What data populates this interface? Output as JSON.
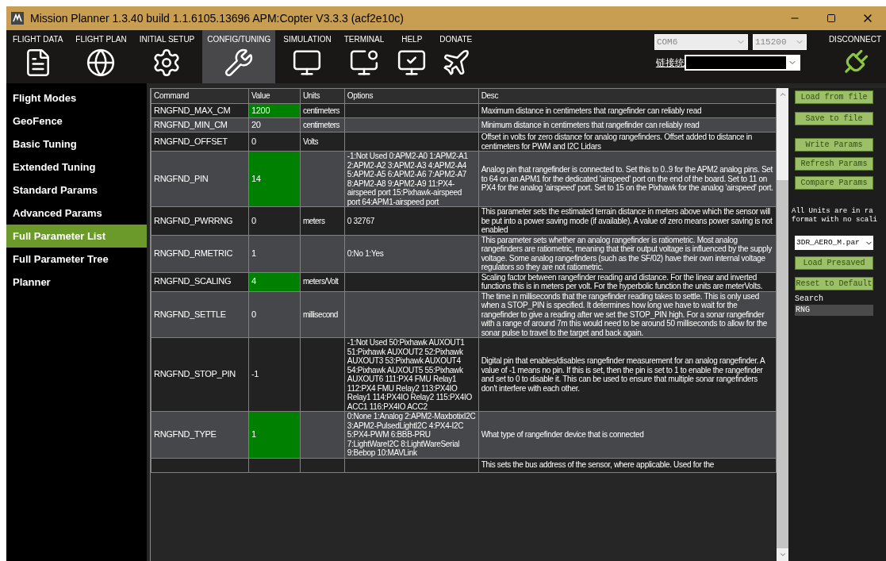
{
  "window": {
    "title": "Mission Planner 1.3.40 build 1.1.6105.13696 APM:Copter V3.3.3 (acf2e10c)"
  },
  "toolbar": {
    "tabs": [
      {
        "label": "FLIGHT DATA",
        "selected": false
      },
      {
        "label": "FLIGHT PLAN",
        "selected": false
      },
      {
        "label": "INITIAL SETUP",
        "selected": false
      },
      {
        "label": "CONFIG/TUNING",
        "selected": true
      },
      {
        "label": "SIMULATION",
        "selected": false
      },
      {
        "label": "TERMINAL",
        "selected": false
      },
      {
        "label": "HELP",
        "selected": false
      },
      {
        "label": "DONATE",
        "selected": false
      }
    ],
    "port": "COM6",
    "baud": "115200",
    "link_stats": "链接统",
    "disconnect": "DISCONNECT"
  },
  "sidebar": {
    "items": [
      {
        "label": "Flight Modes",
        "selected": false
      },
      {
        "label": "GeoFence",
        "selected": false
      },
      {
        "label": "Basic Tuning",
        "selected": false
      },
      {
        "label": "Extended Tuning",
        "selected": false
      },
      {
        "label": "Standard Params",
        "selected": false
      },
      {
        "label": "Advanced Params",
        "selected": false
      },
      {
        "label": "Full Parameter List",
        "selected": true
      },
      {
        "label": "Full Parameter Tree",
        "selected": false
      },
      {
        "label": "Planner",
        "selected": false
      }
    ]
  },
  "table": {
    "columns": [
      "Command",
      "Value",
      "Units",
      "Options",
      "Desc"
    ],
    "rows": [
      {
        "command": "RNGFND_MAX_CM",
        "value": "1200",
        "highlighted": true,
        "units": "centimeters",
        "options": "",
        "desc": "Maximum distance in centimeters that rangefinder can reliably read"
      },
      {
        "command": "RNGFND_MIN_CM",
        "value": "20",
        "highlighted": false,
        "units": "centimeters",
        "options": "",
        "desc": "Minimum distance in centimeters that rangefinder can reliably read"
      },
      {
        "command": "RNGFND_OFFSET",
        "value": "0",
        "highlighted": false,
        "units": "Volts",
        "options": "",
        "desc": "Offset in volts for zero distance for analog rangefinders. Offset added to distance in centimeters for PWM and I2C Lidars"
      },
      {
        "command": "RNGFND_PIN",
        "value": "14",
        "highlighted": true,
        "units": "",
        "options": "-1:Not Used  0:APM2-A0 1:APM2-A1  2:APM2-A2 3:APM2-A3  4:APM2-A4 5:APM2-A5  6:APM2-A6 7:APM2-A7  8:APM2-A8 9:APM2-A9  11:PX4-airspeed port 15:Pixhawk-airspeed port 64:APM1-airspeed port",
        "desc": "Analog pin that rangefinder is connected to. Set this to 0..9 for the APM2 analog pins. Set to 64 on an APM1 for the dedicated 'airspeed' port on the end of the board. Set to 11 on PX4 for the analog 'airspeed' port. Set to 15 on the Pixhawk for the analog 'airspeed' port."
      },
      {
        "command": "RNGFND_PWRRNG",
        "value": "0",
        "highlighted": false,
        "units": "meters",
        "options": "0 32767",
        "desc": "This parameter sets the estimated terrain distance in meters above which the sensor will be put into a power saving mode (if available). A value of zero means power saving is not enabled"
      },
      {
        "command": "RNGFND_RMETRIC",
        "value": "1",
        "highlighted": false,
        "units": "",
        "options": "0:No 1:Yes",
        "desc": "This parameter sets whether an analog rangefinder is ratiometric. Most analog rangefinders are ratiometric, meaning that their output voltage is influenced by the supply voltage. Some analog rangefinders (such as the SF/02) have their own internal voltage regulators so they are not ratiometric."
      },
      {
        "command": "RNGFND_SCALING",
        "value": "4",
        "highlighted": true,
        "units": "meters/Volt",
        "options": "",
        "desc": "Scaling factor between rangefinder reading and distance. For the linear and inverted functions this is in meters per volt. For the hyperbolic function the units are meterVolts."
      },
      {
        "command": "RNGFND_SETTLE",
        "value": "0",
        "highlighted": false,
        "units": "millisecond",
        "options": "",
        "desc": "The time in milliseconds that the rangefinder reading takes to settle. This is only used when a STOP_PIN is specified. It determines how long we have to wait for the rangefinder to give a reading after we set the STOP_PIN high. For a sonar rangefinder with a range of around 7m this would need to be around 50 milliseconds to allow for the sonar pulse to travel to the target and back again."
      },
      {
        "command": "RNGFND_STOP_PIN",
        "value": "-1",
        "highlighted": false,
        "units": "",
        "options": "-1:Not Used 50:Pixhawk AUXOUT1 51:Pixhawk AUXOUT2 52:Pixhawk AUXOUT3 53:Pixhawk AUXOUT4 54:Pixhawk AUXOUT5 55:Pixhawk AUXOUT6 111:PX4 FMU Relay1 112:PX4 FMU Relay2 113:PX4IO Relay1 114:PX4IO Relay2 115:PX4IO ACC1 116:PX4IO ACC2",
        "desc": "Digital pin that enables/disables rangefinder measurement for an analog rangefinder. A value of -1 means no pin. If this is set, then the pin is set to 1 to enable the rangefinder and set to 0 to disable it. This can be used to ensure that multiple sonar rangefinders don't interfere with each other."
      },
      {
        "command": "RNGFND_TYPE",
        "value": "1",
        "highlighted": true,
        "units": "",
        "options": "0:None 1:Analog 2:APM2-MaxbotixI2C 3:APM2-PulsedLightI2C 4:PX4-I2C 5:PX4-PWM 6:BBB-PRU 7:LightWareI2C 8:LightWareSerial 9:Bebop 10:MAVLink",
        "desc": "What type of rangefinder device that is connected"
      },
      {
        "command": "",
        "value": "",
        "highlighted": false,
        "units": "",
        "options": "",
        "desc": "This sets the bus address of the sensor, where applicable. Used for the"
      }
    ]
  },
  "right_panel": {
    "file_buttons": [
      "Load from file",
      "Save to file"
    ],
    "param_buttons": [
      "Write Params",
      "Refresh Params",
      "Compare Params"
    ],
    "note": [
      "All Units are in ra",
      "format with no scali"
    ],
    "preset": "3DR_AERO_M.par",
    "preset_buttons": [
      "Load Presaved",
      "Reset to Default"
    ],
    "search": {
      "label": "Search",
      "value": "RNG"
    }
  }
}
